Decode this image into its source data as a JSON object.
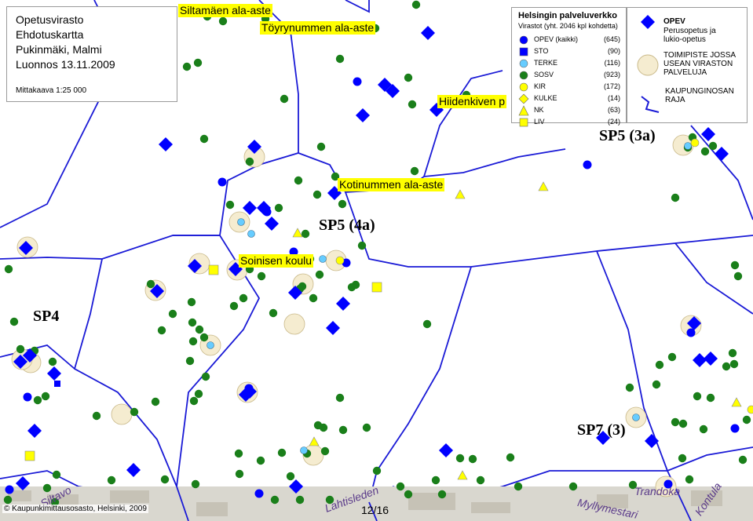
{
  "title_box": {
    "lines": [
      "Opetusvirasto",
      "Ehdotuskartta",
      "Pukinmäki, Malmi",
      "Luonnos 13.11.2009"
    ],
    "scale": "Mittakaava 1:25 000"
  },
  "legend": {
    "title": "Helsingin palveluverkko",
    "subtitle": "Virastot (yht. 2046 kpl kohdetta)",
    "items": [
      {
        "label": "OPEV (kaikki)",
        "count": "(645)",
        "symbol": "circle",
        "color": "#0000ff"
      },
      {
        "label": "STO",
        "count": "(90)",
        "symbol": "square",
        "color": "#0000ff"
      },
      {
        "label": "TERKE",
        "count": "(116)",
        "symbol": "circle",
        "color": "#66ccff"
      },
      {
        "label": "SOSV",
        "count": "(923)",
        "symbol": "circle",
        "color": "#1a7f1a"
      },
      {
        "label": "KIR",
        "count": "(172)",
        "symbol": "circle",
        "color": "#ffff00"
      },
      {
        "label": "KULKE",
        "count": "(14)",
        "symbol": "diamond",
        "color": "#ffff00"
      },
      {
        "label": "NK",
        "count": "(63)",
        "symbol": "triangle",
        "color": "#ffff00"
      },
      {
        "label": "LIV",
        "count": "(24)",
        "symbol": "square",
        "color": "#ffff00"
      }
    ]
  },
  "legend2": {
    "opev_title": "OPEV",
    "opev_desc": [
      "Perusopetus ja",
      "lukio-opetus"
    ],
    "multi_desc": [
      "TOIMIPISTE JOSSA",
      "USEAN VIRASTON",
      "PALVELUJA"
    ],
    "boundary_desc": [
      "KAUPUNGINOSAN",
      "RAJA"
    ]
  },
  "school_labels": [
    "Siltamäen ala-aste",
    "Töyrynummen ala-aste",
    "Hiidenkiven p",
    "Kotinummen ala-aste",
    "Soinisen koulu"
  ],
  "districts": [
    "SP5 (3a)",
    "SP5 (4a)",
    "SP4",
    "SP7 (3)"
  ],
  "streets": [
    "Siltavo",
    "Lahtisleden",
    "Myllymestari",
    "Kontula",
    "Trandoka"
  ],
  "bottom": {
    "copyright": "© Kaupunkimittausosasto, Helsinki, 2009",
    "page": "12/16"
  },
  "colors": {
    "boundary": "#1a1ad6",
    "opev": "#0000ff",
    "sosv": "#1a7f1a",
    "terke": "#66ccff",
    "yellow": "#ffff00",
    "halo": "#f5ecd0"
  }
}
